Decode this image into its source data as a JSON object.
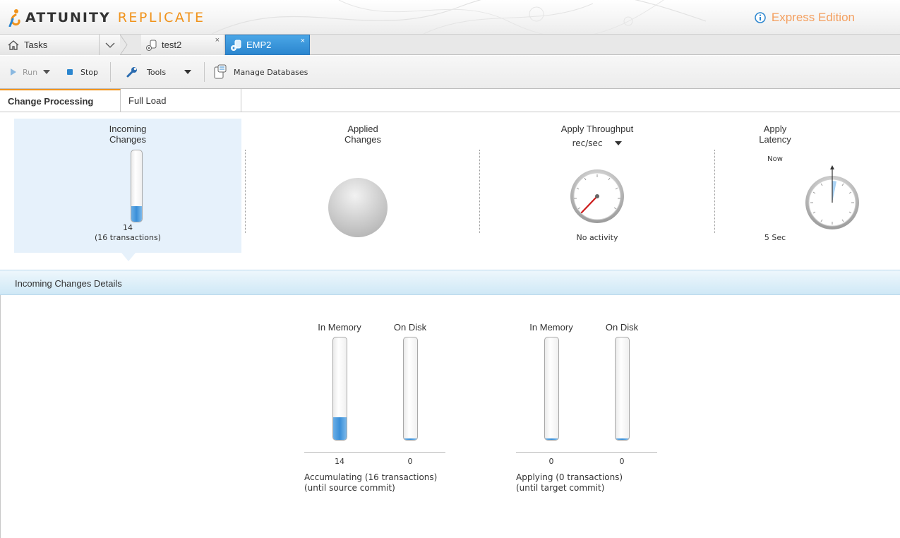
{
  "header": {
    "brand_primary": "ATTUNITY",
    "brand_secondary": "REPLICATE",
    "edition": "Express Edition",
    "accent_color": "#f0931c",
    "edition_icon": "info-icon"
  },
  "tabs": {
    "home_label": "Tasks",
    "items": [
      {
        "label": "test2",
        "active": false
      },
      {
        "label": "EMP2",
        "active": true
      }
    ],
    "close_glyph": "×"
  },
  "toolbar": {
    "run_label": "Run",
    "stop_label": "Stop",
    "tools_label": "Tools",
    "manage_label": "Manage Databases"
  },
  "subtabs": {
    "active": "Change Processing",
    "other": "Full Load"
  },
  "metrics": {
    "incoming": {
      "title_line1": "Incoming",
      "title_line2": "Changes",
      "value": "14",
      "sub": "(16 transactions)",
      "fill_fraction": 0.22
    },
    "applied": {
      "title_line1": "Applied",
      "title_line2": "Changes"
    },
    "throughput": {
      "title": "Apply Throughput",
      "unit": "rec/sec",
      "status": "No activity"
    },
    "latency": {
      "title_line1": "Apply",
      "title_line2": "Latency",
      "marker": "Now",
      "value": "5 Sec"
    }
  },
  "details": {
    "title": "Incoming Changes Details",
    "accumulating": {
      "in_memory_label": "In Memory",
      "on_disk_label": "On Disk",
      "in_memory_value": "14",
      "on_disk_value": "0",
      "in_memory_fill": 0.22,
      "on_disk_fill": 0.0,
      "caption_line1": "Accumulating (16 transactions)",
      "caption_line2": "(until source commit)"
    },
    "applying": {
      "in_memory_label": "In Memory",
      "on_disk_label": "On Disk",
      "in_memory_value": "0",
      "on_disk_value": "0",
      "in_memory_fill": 0.0,
      "on_disk_fill": 0.0,
      "caption_line1": "Applying (0 transactions)",
      "caption_line2": "(until target commit)"
    }
  }
}
